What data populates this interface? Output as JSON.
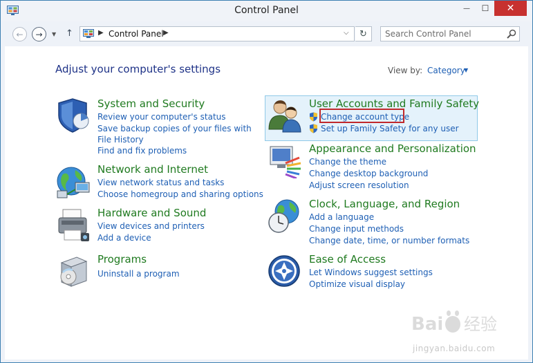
{
  "window": {
    "title": "Control Panel",
    "close_glyph": "✕",
    "min_glyph": "—",
    "max_glyph": "☐"
  },
  "toolbar": {
    "back_glyph": "←",
    "forward_glyph": "→",
    "recent_glyph": "▼",
    "up_glyph": "↑",
    "address_sep": "▶",
    "address_text": "Control Panel",
    "dropdown_glyph": "⌵",
    "refresh_glyph": "↻",
    "search_placeholder": "Search Control Panel"
  },
  "page": {
    "heading": "Adjust your computer's settings",
    "view_by_label": "View by:",
    "view_by_value": "Category",
    "view_by_arrow": "▼"
  },
  "categories": [
    {
      "title": "System and Security",
      "icon": "shield-icon",
      "links": [
        "Review your computer's status",
        "Save backup copies of your files with File History",
        "Find and fix problems"
      ]
    },
    {
      "title": "Network and Internet",
      "icon": "globe-network-icon",
      "links": [
        "View network status and tasks",
        "Choose homegroup and sharing options"
      ]
    },
    {
      "title": "Hardware and Sound",
      "icon": "printer-icon",
      "links": [
        "View devices and printers",
        "Add a device"
      ]
    },
    {
      "title": "Programs",
      "icon": "programs-box-icon",
      "links": [
        "Uninstall a program"
      ]
    },
    {
      "title": "User Accounts and Family Safety",
      "icon": "users-icon",
      "links": [
        "Change account type",
        "Set up Family Safety for any user"
      ]
    },
    {
      "title": "Appearance and Personalization",
      "icon": "monitor-paint-icon",
      "links": [
        "Change the theme",
        "Change desktop background",
        "Adjust screen resolution"
      ]
    },
    {
      "title": "Clock, Language, and Region",
      "icon": "clock-globe-icon",
      "links": [
        "Add a language",
        "Change input methods",
        "Change date, time, or number formats"
      ]
    },
    {
      "title": "Ease of Access",
      "icon": "ease-of-access-icon",
      "links": [
        "Let Windows suggest settings",
        "Optimize visual display"
      ]
    }
  ],
  "watermark": {
    "text": "jingyan.baidu.com",
    "brand": "Bai 经验"
  },
  "colors": {
    "category_title": "#1f7a1f",
    "link": "#1e5fb4",
    "heading": "#1e3287",
    "close_button": "#c7312f",
    "highlight": "#e4f2fb",
    "annotation_box": "#c0282b"
  }
}
